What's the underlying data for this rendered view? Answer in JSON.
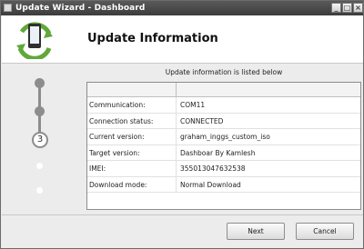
{
  "window": {
    "title": "Update Wizard - Dashboard"
  },
  "titlebar_controls": {
    "minimize": "_",
    "maximize": "□",
    "close": "×"
  },
  "header": {
    "title": "Update Information",
    "icon": "phone-update-icon"
  },
  "steps": {
    "current_label": "3"
  },
  "info": {
    "caption": "Update information is listed below",
    "rows": [
      {
        "key": "Communication:",
        "value": "COM11"
      },
      {
        "key": "Connection status:",
        "value": "CONNECTED"
      },
      {
        "key": "Current version:",
        "value": "graham_inggs_custom_iso"
      },
      {
        "key": "Target version:",
        "value": "Dashboar By Kamlesh"
      },
      {
        "key": "IMEI:",
        "value": "355013047632538"
      },
      {
        "key": "Download mode:",
        "value": "Normal Download"
      }
    ]
  },
  "buttons": {
    "next": "Next",
    "cancel": "Cancel"
  },
  "colors": {
    "titlebar": "#3c3c3c",
    "accent_green": "#5fa83a",
    "step_gray": "#8d8d8d"
  }
}
